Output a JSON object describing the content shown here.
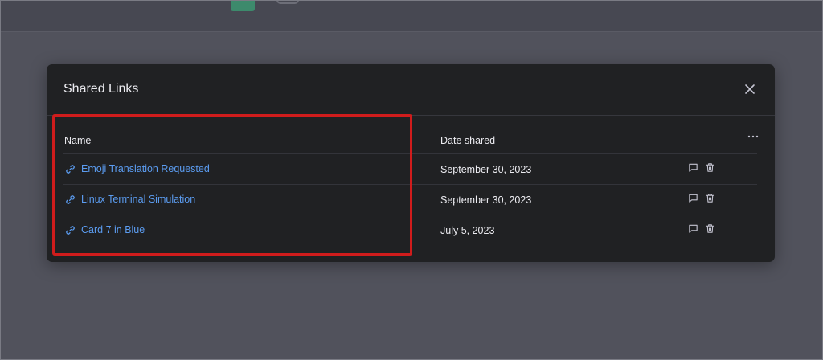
{
  "modal": {
    "title": "Shared Links",
    "close_icon": "close-icon"
  },
  "table": {
    "columns": [
      "Name",
      "Date shared"
    ],
    "more_icon": "more-horizontal-icon",
    "rows": [
      {
        "name": "Emoji Translation Requested",
        "date": "September 30, 2023"
      },
      {
        "name": "Linux Terminal Simulation",
        "date": "September 30, 2023"
      },
      {
        "name": "Card 7 in Blue",
        "date": "July 5, 2023"
      }
    ]
  },
  "colors": {
    "link": "#5b9cf0",
    "modal_bg": "#202123",
    "backdrop": "#51525c",
    "highlight": "#d01c1c"
  }
}
